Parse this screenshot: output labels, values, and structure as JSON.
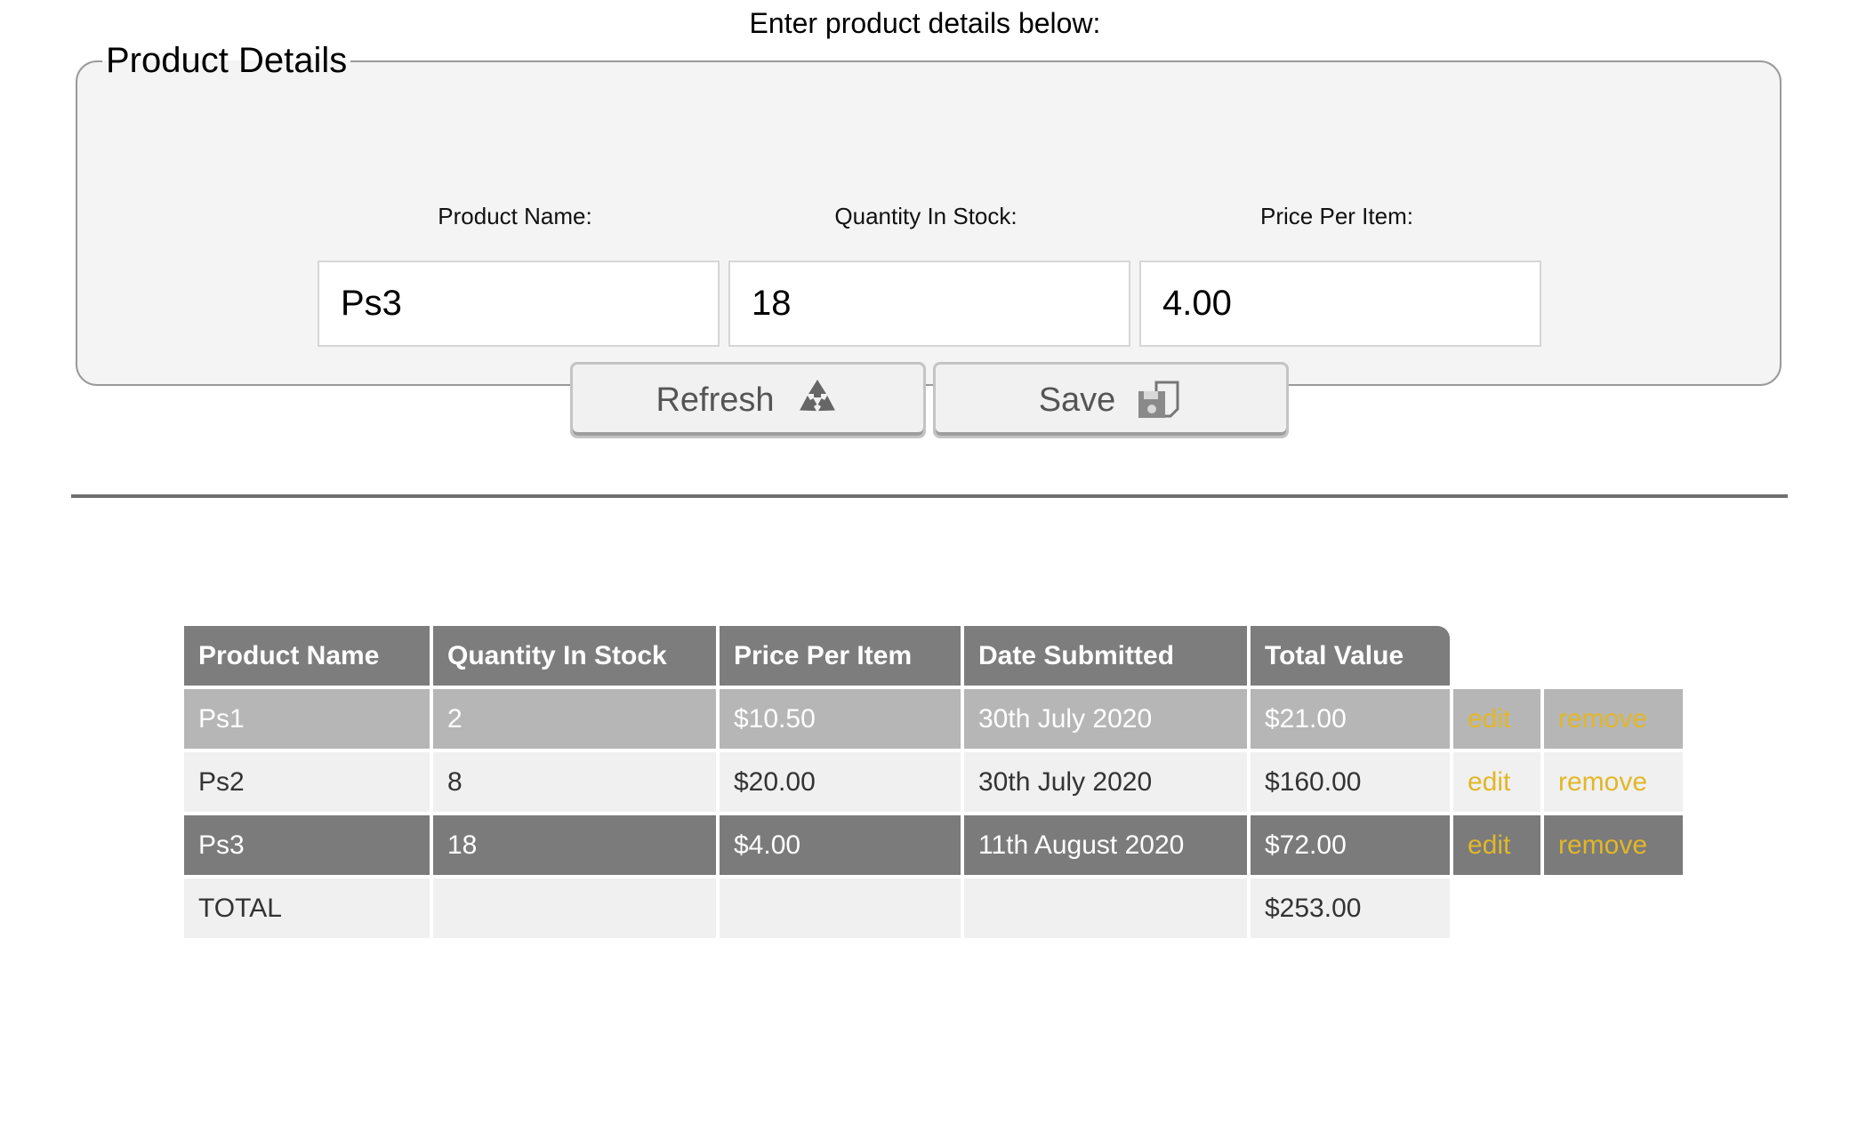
{
  "header": {
    "intro": "Enter product details below:"
  },
  "form": {
    "legend": "Product Details",
    "labels": {
      "product_name": "Product Name:",
      "quantity": "Quantity In Stock:",
      "price": "Price Per Item:"
    },
    "values": {
      "product_name": "Ps3",
      "quantity": "18",
      "price": "4.00"
    },
    "buttons": {
      "refresh": {
        "label": "Refresh",
        "icon": "recycle-icon"
      },
      "save": {
        "label": "Save",
        "icon": "floppy-disk-icon"
      }
    }
  },
  "table": {
    "headers": [
      "Product Name",
      "Quantity In Stock",
      "Price Per Item",
      "Date Submitted",
      "Total Value"
    ],
    "rows": [
      {
        "name": "Ps1",
        "quantity": "2",
        "price": "$10.50",
        "date": "30th July 2020",
        "total": "$21.00",
        "edit": "edit",
        "remove": "remove"
      },
      {
        "name": "Ps2",
        "quantity": "8",
        "price": "$20.00",
        "date": "30th July 2020",
        "total": "$160.00",
        "edit": "edit",
        "remove": "remove"
      },
      {
        "name": "Ps3",
        "quantity": "18",
        "price": "$4.00",
        "date": "11th August 2020",
        "total": "$72.00",
        "edit": "edit",
        "remove": "remove"
      }
    ],
    "total_row": {
      "label": "TOTAL",
      "total": "$253.00"
    }
  },
  "colors": {
    "header_bg": "#7d7d7d",
    "row_light": "#b6b6b6",
    "row_white": "#f0f0f0",
    "row_dark": "#7b7b7b",
    "action_link": "#e2b728",
    "fieldset_bg": "#f4f4f4"
  }
}
